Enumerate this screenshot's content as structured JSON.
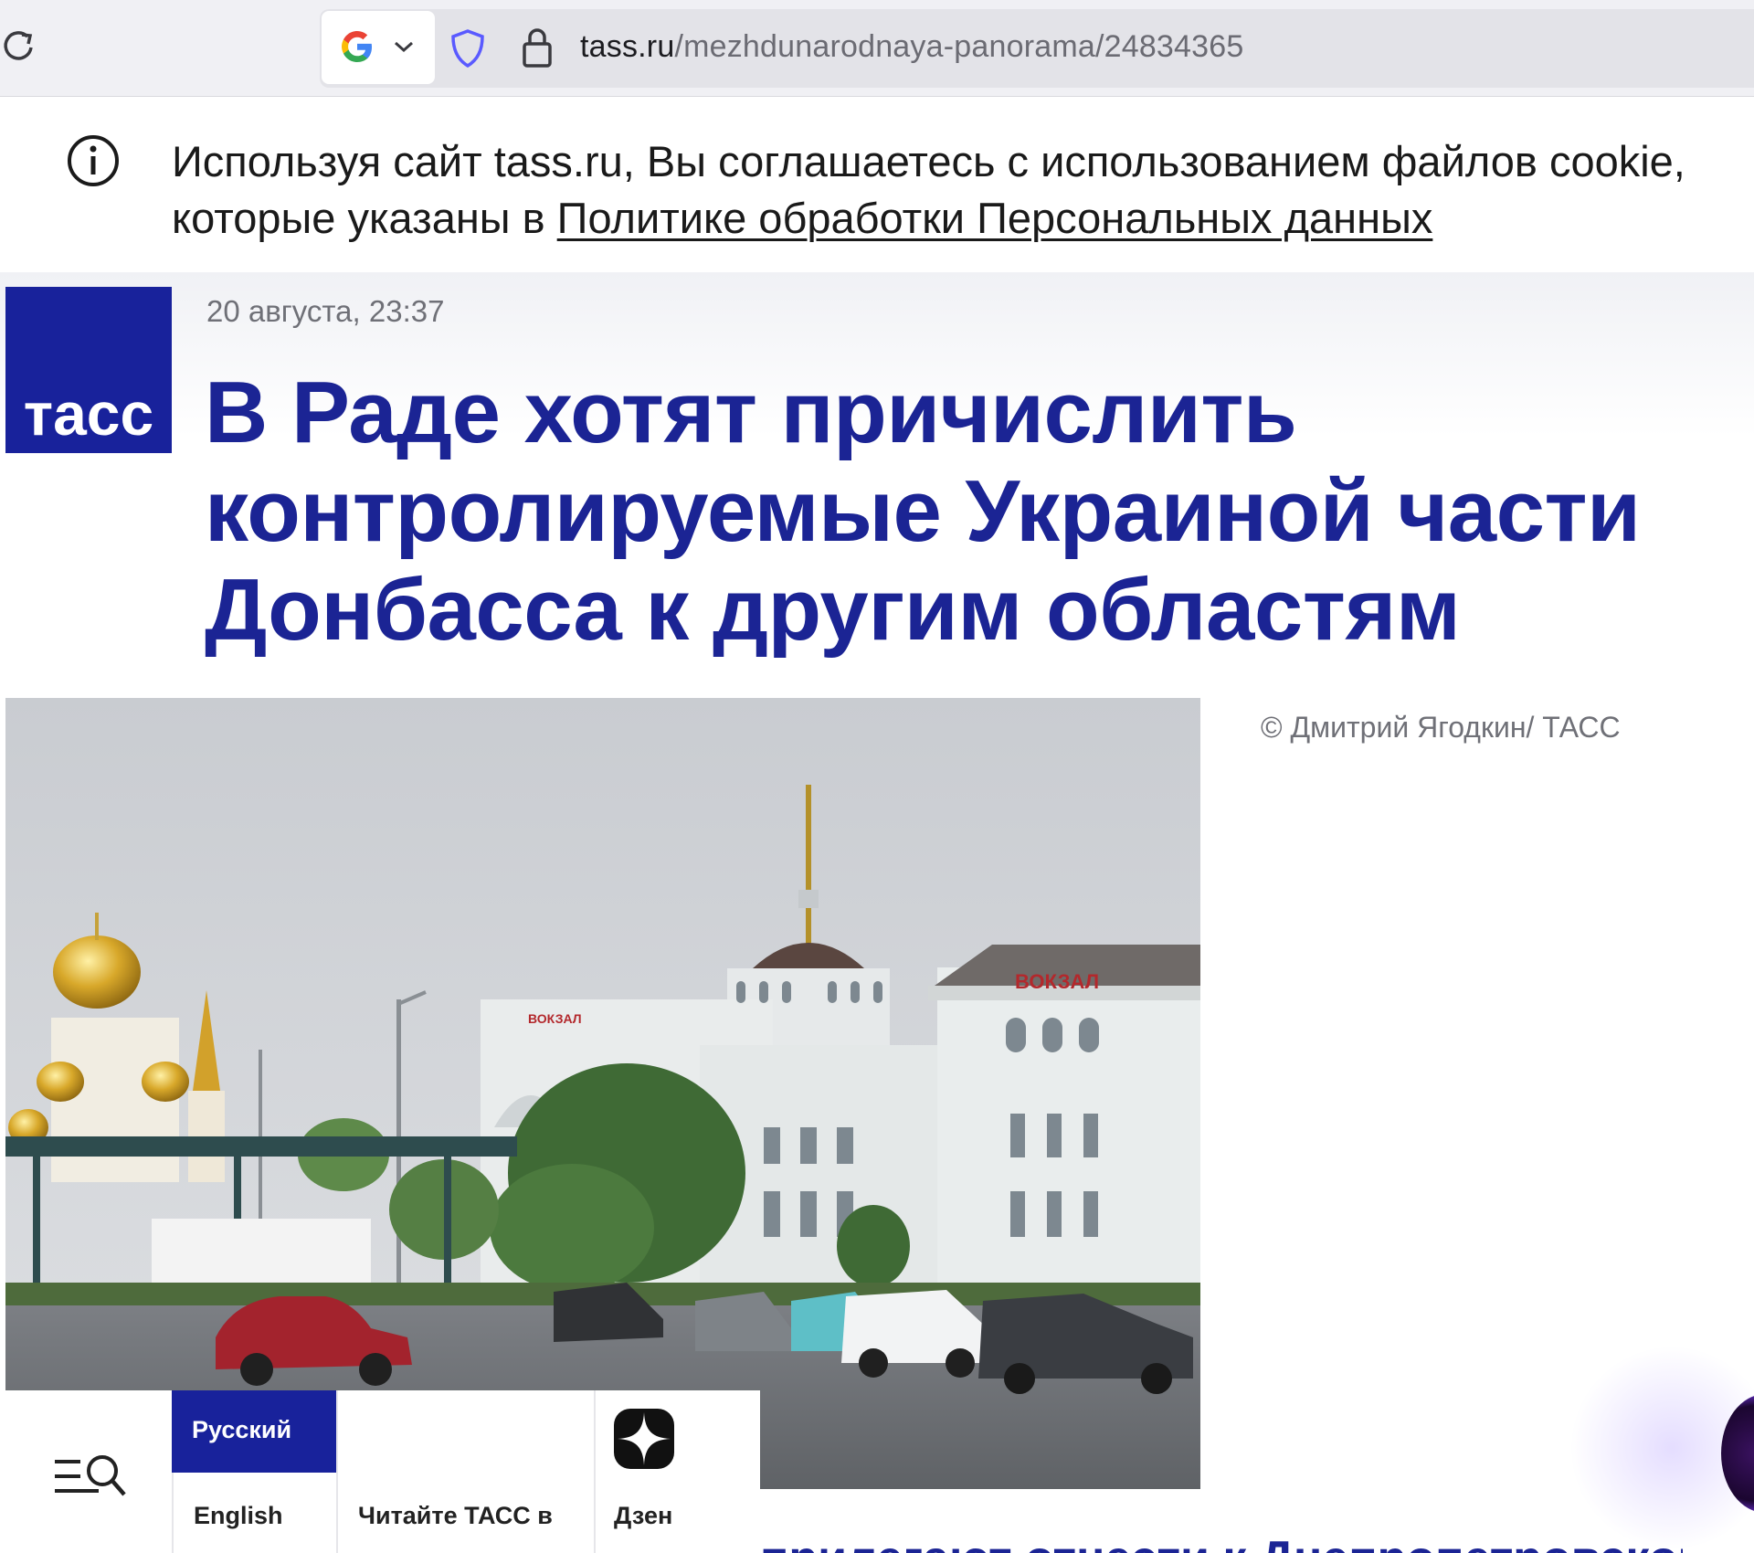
{
  "browser": {
    "url_domain": "tass.ru",
    "url_path": "/mezhdunarodnaya-panorama/24834365",
    "search_engine_icon": "google-g-icon",
    "tracking_icon": "shield-icon",
    "security_icon": "lock-icon"
  },
  "cookie_notice": {
    "text_before_link": "Используя сайт tass.ru, Вы соглашаетесь с использованием файлов cookie, которые указаны в ",
    "link_text": "Политике обработки Персональных данных"
  },
  "brand": {
    "logo_text": "тасс",
    "color": "#18229b"
  },
  "article": {
    "date": "20 августа, 23:37",
    "headline": "В Раде хотят причислить контролируемые Украиной части Донбасса к другим областям",
    "photo_credit": "© Дмитрий Ягодкин/ ТАСС",
    "photo_sign_left": "ВОКЗАЛ",
    "photo_sign_right": "ВОКЗАЛ",
    "next_paragraph_partial": "прилегают отнести к Днепропетровской"
  },
  "bottom_nav": {
    "lang_active": "Русский",
    "lang_other": "English",
    "read_label": "Читайте ТАСС в",
    "dzen_label": "Дзен"
  }
}
